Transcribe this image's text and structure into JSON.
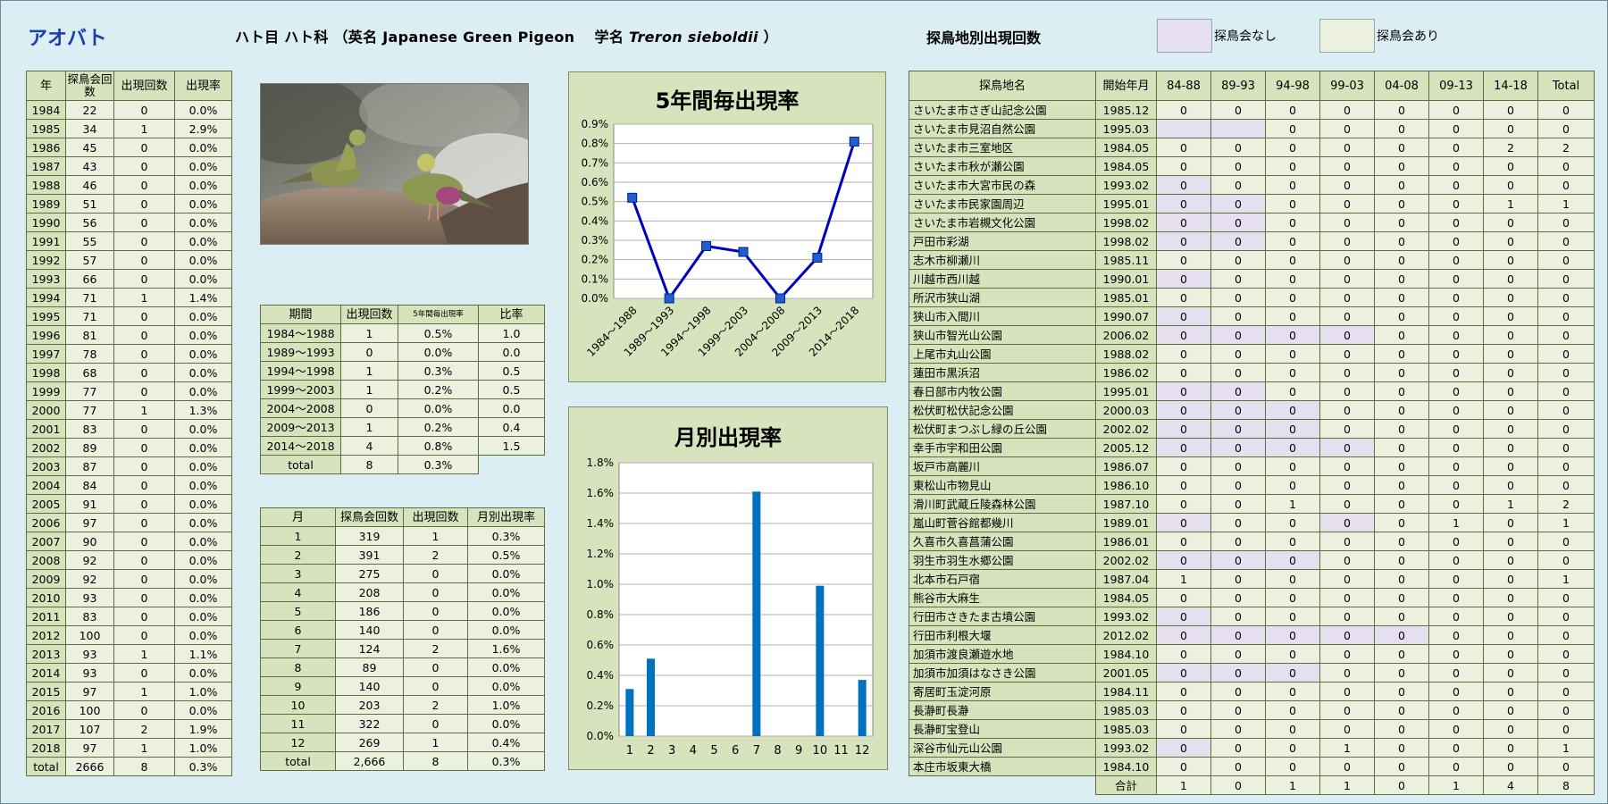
{
  "header": {
    "bird_name": "アオバト",
    "subtitle_prefix": "ハト目 ハト科 （英名 Japanese Green Pigeon　 学名 ",
    "scientific_name": "Treron sieboldii",
    "subtitle_suffix": " ）",
    "site_section_title": "探鳥地別出現回数",
    "legend_none": "探鳥会なし",
    "legend_has": "探鳥会あり",
    "legend_none_color": "#e5dff0",
    "legend_has_color": "#ebf1de"
  },
  "year_table": {
    "headers": [
      "年",
      "探鳥会回数",
      "出現回数",
      "出現率"
    ],
    "rows": [
      [
        "1984",
        "22",
        "0",
        "0.0%"
      ],
      [
        "1985",
        "34",
        "1",
        "2.9%"
      ],
      [
        "1986",
        "45",
        "0",
        "0.0%"
      ],
      [
        "1987",
        "43",
        "0",
        "0.0%"
      ],
      [
        "1988",
        "46",
        "0",
        "0.0%"
      ],
      [
        "1989",
        "51",
        "0",
        "0.0%"
      ],
      [
        "1990",
        "56",
        "0",
        "0.0%"
      ],
      [
        "1991",
        "55",
        "0",
        "0.0%"
      ],
      [
        "1992",
        "57",
        "0",
        "0.0%"
      ],
      [
        "1993",
        "66",
        "0",
        "0.0%"
      ],
      [
        "1994",
        "71",
        "1",
        "1.4%"
      ],
      [
        "1995",
        "71",
        "0",
        "0.0%"
      ],
      [
        "1996",
        "81",
        "0",
        "0.0%"
      ],
      [
        "1997",
        "78",
        "0",
        "0.0%"
      ],
      [
        "1998",
        "68",
        "0",
        "0.0%"
      ],
      [
        "1999",
        "77",
        "0",
        "0.0%"
      ],
      [
        "2000",
        "77",
        "1",
        "1.3%"
      ],
      [
        "2001",
        "83",
        "0",
        "0.0%"
      ],
      [
        "2002",
        "89",
        "0",
        "0.0%"
      ],
      [
        "2003",
        "87",
        "0",
        "0.0%"
      ],
      [
        "2004",
        "84",
        "0",
        "0.0%"
      ],
      [
        "2005",
        "91",
        "0",
        "0.0%"
      ],
      [
        "2006",
        "97",
        "0",
        "0.0%"
      ],
      [
        "2007",
        "90",
        "0",
        "0.0%"
      ],
      [
        "2008",
        "92",
        "0",
        "0.0%"
      ],
      [
        "2009",
        "92",
        "0",
        "0.0%"
      ],
      [
        "2010",
        "93",
        "0",
        "0.0%"
      ],
      [
        "2011",
        "83",
        "0",
        "0.0%"
      ],
      [
        "2012",
        "100",
        "0",
        "0.0%"
      ],
      [
        "2013",
        "93",
        "1",
        "1.1%"
      ],
      [
        "2014",
        "93",
        "0",
        "0.0%"
      ],
      [
        "2015",
        "97",
        "1",
        "1.0%"
      ],
      [
        "2016",
        "100",
        "0",
        "0.0%"
      ],
      [
        "2017",
        "107",
        "2",
        "1.9%"
      ],
      [
        "2018",
        "97",
        "1",
        "1.0%"
      ]
    ],
    "total": [
      "total",
      "2666",
      "8",
      "0.3%"
    ]
  },
  "period_table": {
    "headers": [
      "期間",
      "出現回数",
      "5年間毎出現率",
      "比率"
    ],
    "rows": [
      [
        "1984～1988",
        "1",
        "0.5%",
        "1.0"
      ],
      [
        "1989～1993",
        "0",
        "0.0%",
        "0.0"
      ],
      [
        "1994～1998",
        "1",
        "0.3%",
        "0.5"
      ],
      [
        "1999～2003",
        "1",
        "0.2%",
        "0.5"
      ],
      [
        "2004～2008",
        "0",
        "0.0%",
        "0.0"
      ],
      [
        "2009～2013",
        "1",
        "0.2%",
        "0.4"
      ],
      [
        "2014～2018",
        "4",
        "0.8%",
        "1.5"
      ]
    ],
    "total": [
      "total",
      "8",
      "0.3%"
    ]
  },
  "month_table": {
    "headers": [
      "月",
      "探鳥会回数",
      "出現回数",
      "月別出現率"
    ],
    "rows": [
      [
        "1",
        "319",
        "1",
        "0.3%"
      ],
      [
        "2",
        "391",
        "2",
        "0.5%"
      ],
      [
        "3",
        "275",
        "0",
        "0.0%"
      ],
      [
        "4",
        "208",
        "0",
        "0.0%"
      ],
      [
        "5",
        "186",
        "0",
        "0.0%"
      ],
      [
        "6",
        "140",
        "0",
        "0.0%"
      ],
      [
        "7",
        "124",
        "2",
        "1.6%"
      ],
      [
        "8",
        "89",
        "0",
        "0.0%"
      ],
      [
        "9",
        "140",
        "0",
        "0.0%"
      ],
      [
        "10",
        "203",
        "2",
        "1.0%"
      ],
      [
        "11",
        "322",
        "0",
        "0.0%"
      ],
      [
        "12",
        "269",
        "1",
        "0.4%"
      ]
    ],
    "total": [
      "total",
      "2,666",
      "8",
      "0.3%"
    ]
  },
  "chart_data": [
    {
      "type": "line",
      "title": "5年間毎出現率",
      "categories": [
        "1984～1988",
        "1989～1993",
        "1994～1998",
        "1999～2003",
        "2004～2008",
        "2009～2013",
        "2014～2018"
      ],
      "values": [
        0.52,
        0.0,
        0.27,
        0.24,
        0.0,
        0.21,
        0.81
      ],
      "ylim": [
        0,
        0.9
      ],
      "yticks": [
        "0.0%",
        "0.1%",
        "0.2%",
        "0.3%",
        "0.4%",
        "0.5%",
        "0.6%",
        "0.7%",
        "0.8%",
        "0.9%"
      ],
      "grid": true,
      "color": "#0000c0",
      "marker_color": "#1f5fd1"
    },
    {
      "type": "bar",
      "title": "月別出現率",
      "categories": [
        "1",
        "2",
        "3",
        "4",
        "5",
        "6",
        "7",
        "8",
        "9",
        "10",
        "11",
        "12"
      ],
      "values": [
        0.31,
        0.51,
        0,
        0,
        0,
        0,
        1.61,
        0,
        0,
        0.99,
        0,
        0.37
      ],
      "ylim": [
        0,
        1.8
      ],
      "yticks": [
        "0.0%",
        "0.2%",
        "0.4%",
        "0.6%",
        "0.8%",
        "1.0%",
        "1.2%",
        "1.4%",
        "1.6%",
        "1.8%"
      ],
      "grid": true,
      "color": "#0070c0"
    }
  ],
  "site_table": {
    "headers": [
      "探鳥地名",
      "開始年月",
      "84-88",
      "89-93",
      "94-98",
      "99-03",
      "04-08",
      "09-13",
      "14-18",
      "Total"
    ],
    "rows": [
      {
        "name": "さいたま市さぎ山記念公園",
        "start": "1985.12",
        "v": [
          "0",
          "0",
          "0",
          "0",
          "0",
          "0",
          "0",
          "0"
        ],
        "h": []
      },
      {
        "name": "さいたま市見沼自然公園",
        "start": "1995.03",
        "v": [
          "",
          "",
          "0",
          "0",
          "0",
          "0",
          "0",
          "0"
        ],
        "h": [
          0,
          1
        ]
      },
      {
        "name": "さいたま市三室地区",
        "start": "1984.05",
        "v": [
          "0",
          "0",
          "0",
          "0",
          "0",
          "0",
          "2",
          "2"
        ],
        "h": []
      },
      {
        "name": "さいたま市秋が瀬公園",
        "start": "1984.05",
        "v": [
          "0",
          "0",
          "0",
          "0",
          "0",
          "0",
          "0",
          "0"
        ],
        "h": []
      },
      {
        "name": "さいたま市大宮市民の森",
        "start": "1993.02",
        "v": [
          "0",
          "0",
          "0",
          "0",
          "0",
          "0",
          "0",
          "0"
        ],
        "h": [
          0
        ]
      },
      {
        "name": "さいたま市民家園周辺",
        "start": "1995.01",
        "v": [
          "0",
          "0",
          "0",
          "0",
          "0",
          "0",
          "1",
          "1"
        ],
        "h": [
          0,
          1
        ]
      },
      {
        "name": "さいたま市岩槻文化公園",
        "start": "1998.02",
        "v": [
          "0",
          "0",
          "0",
          "0",
          "0",
          "0",
          "0",
          "0"
        ],
        "h": [
          0,
          1
        ]
      },
      {
        "name": "戸田市彩湖",
        "start": "1998.02",
        "v": [
          "0",
          "0",
          "0",
          "0",
          "0",
          "0",
          "0",
          "0"
        ],
        "h": [
          0,
          1
        ]
      },
      {
        "name": "志木市柳瀬川",
        "start": "1985.11",
        "v": [
          "0",
          "0",
          "0",
          "0",
          "0",
          "0",
          "0",
          "0"
        ],
        "h": []
      },
      {
        "name": "川越市西川越",
        "start": "1990.01",
        "v": [
          "0",
          "0",
          "0",
          "0",
          "0",
          "0",
          "0",
          "0"
        ],
        "h": [
          0
        ]
      },
      {
        "name": "所沢市狭山湖",
        "start": "1985.01",
        "v": [
          "0",
          "0",
          "0",
          "0",
          "0",
          "0",
          "0",
          "0"
        ],
        "h": []
      },
      {
        "name": "狭山市入間川",
        "start": "1990.07",
        "v": [
          "0",
          "0",
          "0",
          "0",
          "0",
          "0",
          "0",
          "0"
        ],
        "h": [
          0
        ]
      },
      {
        "name": "狭山市智光山公園",
        "start": "2006.02",
        "v": [
          "0",
          "0",
          "0",
          "0",
          "0",
          "0",
          "0",
          "0"
        ],
        "h": [
          0,
          1,
          2,
          3
        ]
      },
      {
        "name": "上尾市丸山公園",
        "start": "1988.02",
        "v": [
          "0",
          "0",
          "0",
          "0",
          "0",
          "0",
          "0",
          "0"
        ],
        "h": []
      },
      {
        "name": "蓮田市黒浜沼",
        "start": "1986.02",
        "v": [
          "0",
          "0",
          "0",
          "0",
          "0",
          "0",
          "0",
          "0"
        ],
        "h": []
      },
      {
        "name": "春日部市内牧公園",
        "start": "1995.01",
        "v": [
          "0",
          "0",
          "0",
          "0",
          "0",
          "0",
          "0",
          "0"
        ],
        "h": [
          0,
          1
        ]
      },
      {
        "name": "松伏町松伏記念公園",
        "start": "2000.03",
        "v": [
          "0",
          "0",
          "0",
          "0",
          "0",
          "0",
          "0",
          "0"
        ],
        "h": [
          0,
          1,
          2
        ]
      },
      {
        "name": "松伏町まつぶし緑の丘公園",
        "start": "2002.02",
        "v": [
          "0",
          "0",
          "0",
          "0",
          "0",
          "0",
          "0",
          "0"
        ],
        "h": [
          0,
          1,
          2
        ]
      },
      {
        "name": "幸手市宇和田公園",
        "start": "2005.12",
        "v": [
          "0",
          "0",
          "0",
          "0",
          "0",
          "0",
          "0",
          "0"
        ],
        "h": [
          0,
          1,
          2,
          3
        ]
      },
      {
        "name": "坂戸市高麗川",
        "start": "1986.07",
        "v": [
          "0",
          "0",
          "0",
          "0",
          "0",
          "0",
          "0",
          "0"
        ],
        "h": []
      },
      {
        "name": "東松山市物見山",
        "start": "1986.10",
        "v": [
          "0",
          "0",
          "0",
          "0",
          "0",
          "0",
          "0",
          "0"
        ],
        "h": []
      },
      {
        "name": "滑川町武蔵丘陵森林公園",
        "start": "1987.10",
        "v": [
          "0",
          "0",
          "1",
          "0",
          "0",
          "0",
          "1",
          "2"
        ],
        "h": []
      },
      {
        "name": "嵐山町菅谷館都幾川",
        "start": "1989.01",
        "v": [
          "0",
          "0",
          "0",
          "0",
          "0",
          "1",
          "0",
          "1"
        ],
        "h": [
          0,
          3
        ]
      },
      {
        "name": "久喜市久喜菖蒲公園",
        "start": "1986.01",
        "v": [
          "0",
          "0",
          "0",
          "0",
          "0",
          "0",
          "0",
          "0"
        ],
        "h": []
      },
      {
        "name": "羽生市羽生水郷公園",
        "start": "2002.02",
        "v": [
          "0",
          "0",
          "0",
          "0",
          "0",
          "0",
          "0",
          "0"
        ],
        "h": [
          0,
          1,
          2
        ]
      },
      {
        "name": "北本市石戸宿",
        "start": "1987.04",
        "v": [
          "1",
          "0",
          "0",
          "0",
          "0",
          "0",
          "0",
          "1"
        ],
        "h": []
      },
      {
        "name": "熊谷市大麻生",
        "start": "1984.05",
        "v": [
          "0",
          "0",
          "0",
          "0",
          "0",
          "0",
          "0",
          "0"
        ],
        "h": []
      },
      {
        "name": "行田市さきたま古墳公園",
        "start": "1993.02",
        "v": [
          "0",
          "0",
          "0",
          "0",
          "0",
          "0",
          "0",
          "0"
        ],
        "h": [
          0
        ]
      },
      {
        "name": "行田市利根大堰",
        "start": "2012.02",
        "v": [
          "0",
          "0",
          "0",
          "0",
          "0",
          "0",
          "0",
          "0"
        ],
        "h": [
          0,
          1,
          2,
          3,
          4
        ]
      },
      {
        "name": "加須市渡良瀬遊水地",
        "start": "1984.10",
        "v": [
          "0",
          "0",
          "0",
          "0",
          "0",
          "0",
          "0",
          "0"
        ],
        "h": []
      },
      {
        "name": "加須市加須はなさき公園",
        "start": "2001.05",
        "v": [
          "0",
          "0",
          "0",
          "0",
          "0",
          "0",
          "0",
          "0"
        ],
        "h": [
          0,
          1,
          2
        ]
      },
      {
        "name": "寄居町玉淀河原",
        "start": "1984.11",
        "v": [
          "0",
          "0",
          "0",
          "0",
          "0",
          "0",
          "0",
          "0"
        ],
        "h": []
      },
      {
        "name": "長瀞町長瀞",
        "start": "1985.03",
        "v": [
          "0",
          "0",
          "0",
          "0",
          "0",
          "0",
          "0",
          "0"
        ],
        "h": []
      },
      {
        "name": "長瀞町宝登山",
        "start": "1985.03",
        "v": [
          "0",
          "0",
          "0",
          "0",
          "0",
          "0",
          "0",
          "0"
        ],
        "h": []
      },
      {
        "name": "深谷市仙元山公園",
        "start": "1993.02",
        "v": [
          "0",
          "0",
          "0",
          "1",
          "0",
          "0",
          "0",
          "1"
        ],
        "h": [
          0
        ]
      },
      {
        "name": "本庄市坂東大橋",
        "start": "1984.10",
        "v": [
          "0",
          "0",
          "0",
          "0",
          "0",
          "0",
          "0",
          "0"
        ],
        "h": []
      }
    ],
    "total_label": "合計",
    "total_values": [
      "1",
      "0",
      "1",
      "1",
      "0",
      "1",
      "4",
      "8"
    ]
  }
}
